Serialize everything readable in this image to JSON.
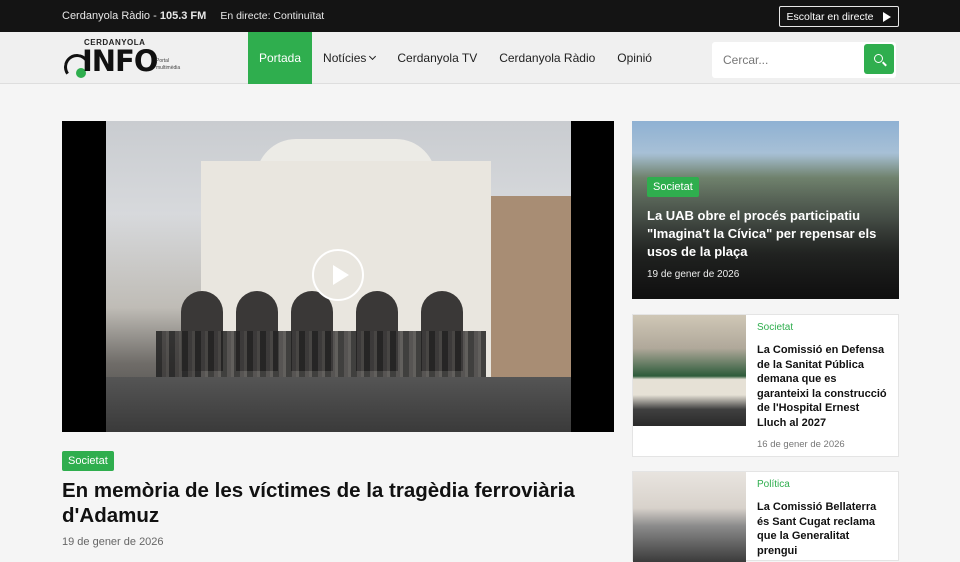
{
  "topbar": {
    "station": "Cerdanyola Ràdio - ",
    "frequency": "105.3 FM",
    "live_status": "En directe: Continuïtat",
    "listen_label": "Escoltar en directe"
  },
  "logo": {
    "top_text": "CERDANYOLA",
    "main_text": "INFO",
    "subtitle": "Portal multimèdia"
  },
  "menu": [
    {
      "label": "Portada",
      "active": true
    },
    {
      "label": "Notícies",
      "dropdown": true
    },
    {
      "label": "Cerdanyola TV"
    },
    {
      "label": "Cerdanyola Ràdio"
    },
    {
      "label": "Opinió"
    }
  ],
  "search": {
    "placeholder": "Cercar..."
  },
  "main_story": {
    "category": "Societat",
    "title": "En memòria de les víctimes de la tragèdia ferroviària d'Adamuz",
    "date": "19 de gener de 2026"
  },
  "side_stories": [
    {
      "category": "Societat",
      "title": "La UAB obre el procés participatiu \"Imagina't la Cívica\" per repensar els usos de la plaça",
      "date": "19 de gener de 2026"
    },
    {
      "category": "Societat",
      "title": "La Comissió en Defensa de la Sanitat Pública demana que es garanteixi la construcció de l'Hospital Ernest Lluch al 2027",
      "date": "16 de gener de 2026"
    },
    {
      "category": "Política",
      "title": "La Comissió Bellaterra és Sant Cugat reclama que la Generalitat prengui",
      "date": ""
    }
  ],
  "colors": {
    "accent": "#2fae4e",
    "topbar": "#141414"
  }
}
